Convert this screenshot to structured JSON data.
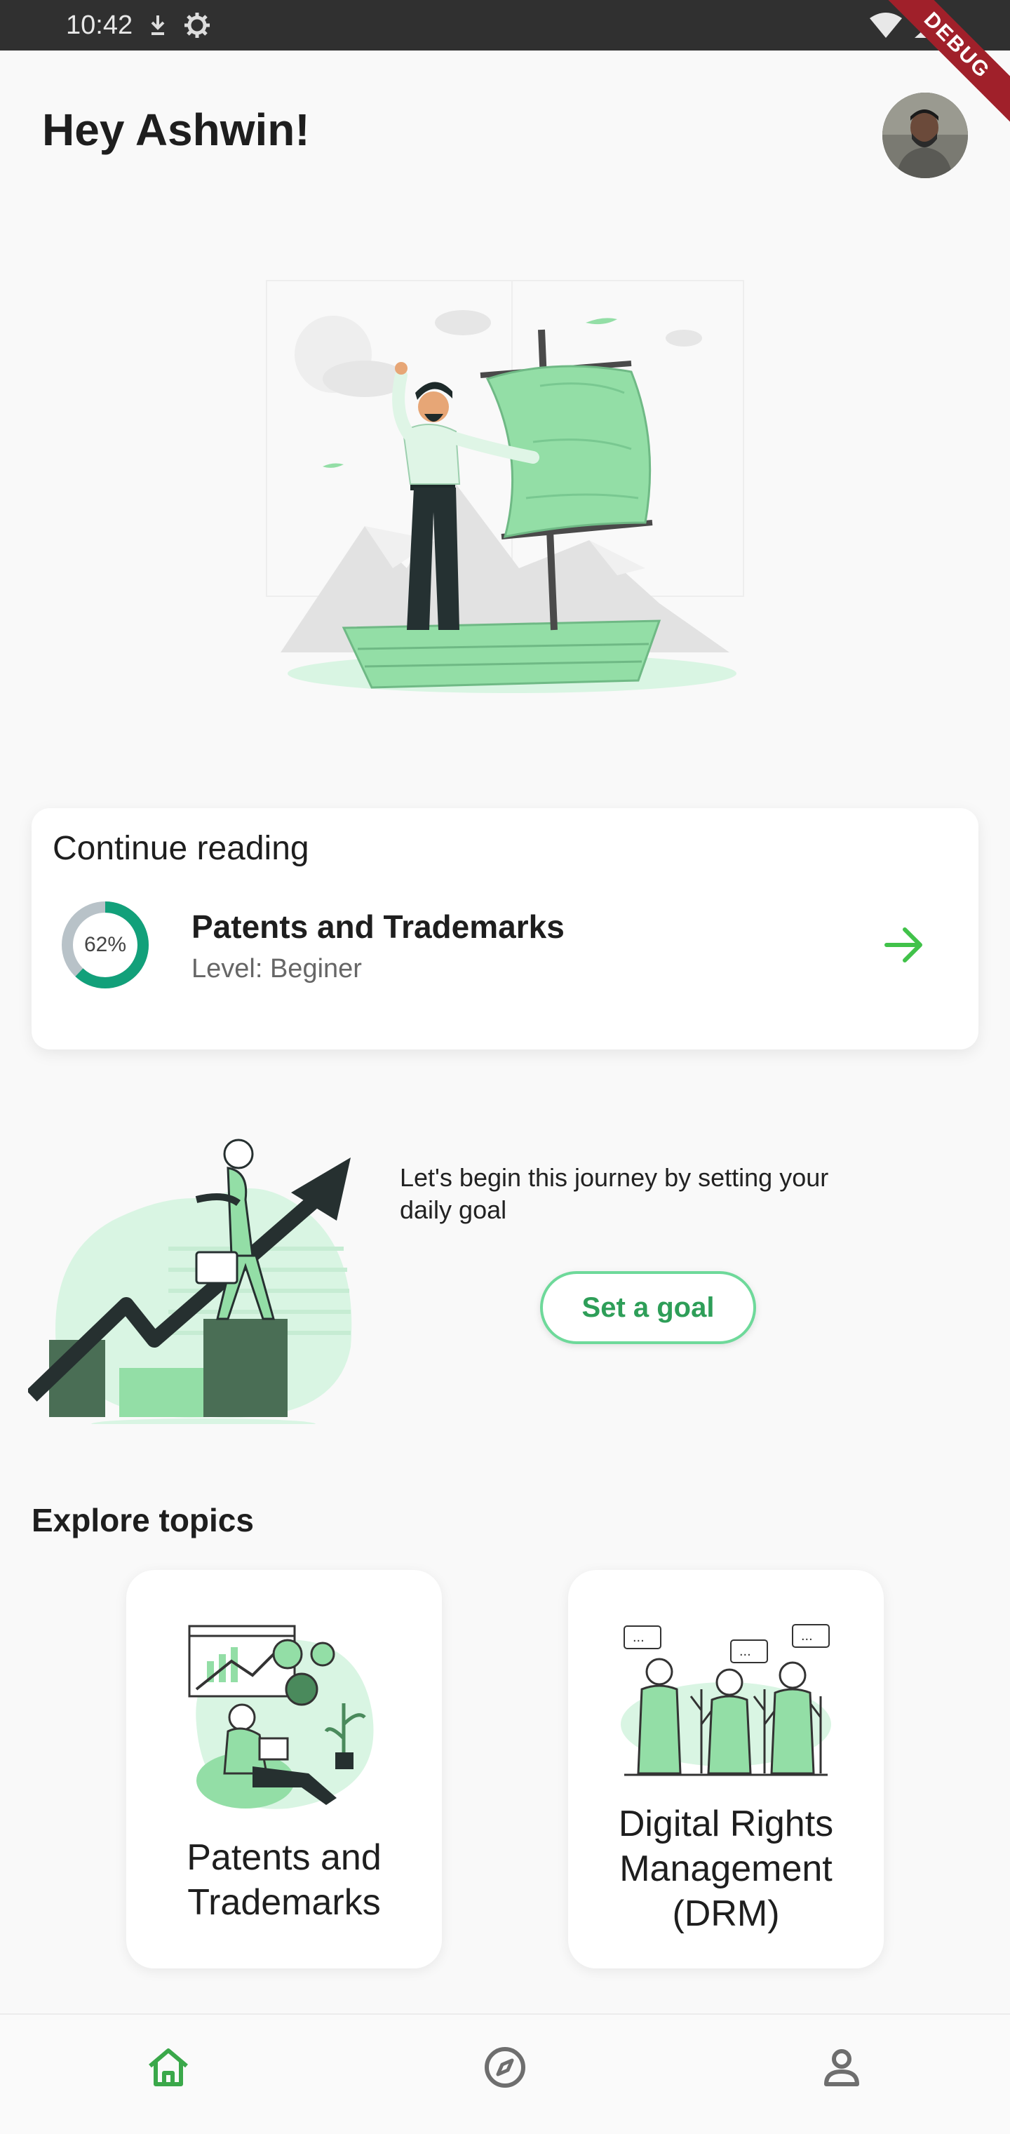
{
  "status_bar": {
    "time": "10:42"
  },
  "debug_banner": "DEBUG",
  "header": {
    "greeting": "Hey Ashwin!"
  },
  "continue_reading": {
    "title": "Continue reading",
    "course": "Patents and Trademarks",
    "level": "Level: Beginer",
    "progress_label": "62%",
    "progress": 0.62
  },
  "goal": {
    "text": "Let's begin this journey by setting your daily goal",
    "button": "Set a goal"
  },
  "explore": {
    "title": "Explore topics",
    "topics": [
      {
        "line1": "Patents and",
        "line2": "Trademarks",
        "line3": ""
      },
      {
        "line1": "Digital Rights",
        "line2": "Management",
        "line3": "(DRM)"
      }
    ]
  },
  "nav": {
    "items": [
      {
        "icon": "home-icon",
        "active": true
      },
      {
        "icon": "compass-icon",
        "active": false
      },
      {
        "icon": "person-icon",
        "active": false
      }
    ]
  },
  "colors": {
    "accent": "#2e9e58",
    "progress": "#12a07a",
    "arrow": "#41c24a",
    "track": "#b8c2c8"
  }
}
